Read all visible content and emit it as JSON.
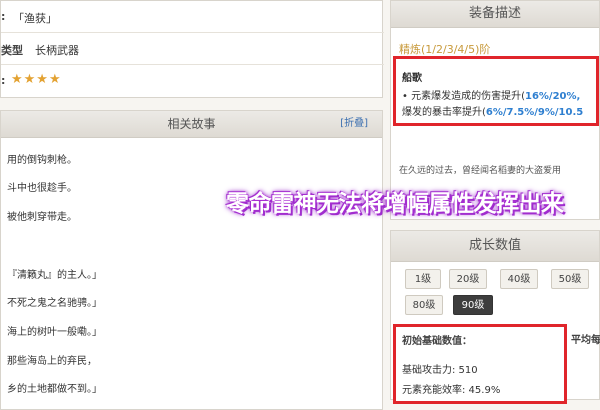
{
  "info": {
    "name_key": ":",
    "name_value": "「渔获」",
    "type_key": "类型",
    "type_value": "长柄武器",
    "rarity_key": ":",
    "stars": "★★★★"
  },
  "story": {
    "title": "相关故事",
    "fold_label": "[折叠]",
    "lines": [
      "用的倒钩刺枪。",
      "斗中也很趁手。",
      "被他刺穿带走。",
      "『清籁丸』的主人。」",
      "不死之鬼之名驰骋。」",
      "海上的树叶一般嘞。」",
      "那些海岛上的弃民，",
      "乡的土地都做不到。」"
    ]
  },
  "equip": {
    "title": "装备描述",
    "refine": "精炼(1/2/3/4/5)阶",
    "skill_name": "船歌",
    "skill_line1_prefix": "• 元素爆发造成的伤害提升(",
    "skill_line1_value": "16%/20%,",
    "skill_line2_prefix": "爆发的暴击率提升(",
    "skill_line2_value": "6%/7.5%/9%/10.5",
    "lore": "在久远的过去，曾经闻名稻妻的大盗爱用"
  },
  "caption": "零命雷神无法将增幅属性发挥出来",
  "growth": {
    "title": "成长数值",
    "levels": [
      "1级",
      "20级",
      "40级",
      "50级",
      "80级",
      "90级"
    ],
    "base_title": "初始基础数值：",
    "avg_title": "平均每",
    "attack": "基础攻击力: 510",
    "recharge": "元素充能效率: 45.9%"
  },
  "colors": {
    "highlight_border": "#e0252b",
    "value_blue": "#2e7fd0",
    "caption_glow": "#a02fcf",
    "refine_gold": "#c89a3b",
    "star": "#e3a232"
  }
}
